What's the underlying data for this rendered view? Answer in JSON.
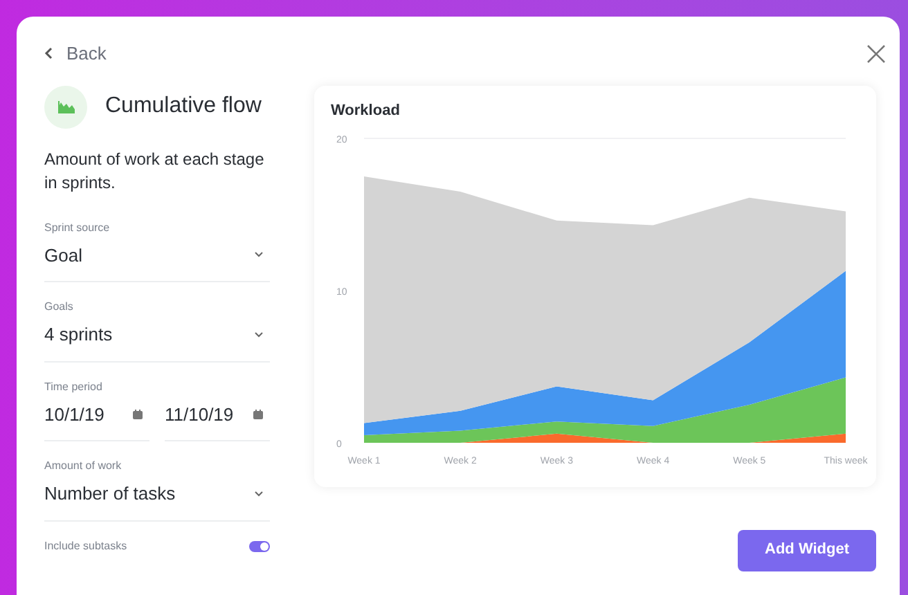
{
  "back": {
    "label": "Back"
  },
  "widget": {
    "title": "Cumulative flow",
    "description": "Amount of work at each stage in sprints."
  },
  "fields": [
    {
      "kind": "select",
      "label": "Sprint source",
      "value": "Goal"
    },
    {
      "kind": "select",
      "label": "Goals",
      "value": "4 sprints"
    },
    {
      "kind": "daterange",
      "label": "Time period",
      "start": "10/1/19",
      "end": "11/10/19"
    },
    {
      "kind": "select",
      "label": "Amount of work",
      "value": "Number of tasks"
    },
    {
      "kind": "toggle",
      "label": "Include subtasks",
      "on": true
    }
  ],
  "preview": {
    "title": "Workload",
    "chart_data": {
      "type": "area",
      "stacked": true,
      "categories": [
        "Week 1",
        "Week 2",
        "Week 3",
        "Week 4",
        "Week 5",
        "This week"
      ],
      "ylim": [
        0,
        20
      ],
      "yticks": [
        0,
        10,
        20
      ],
      "series": [
        {
          "color": "#fa6a2c",
          "values": [
            0,
            0,
            0.6,
            0,
            0,
            0.6
          ]
        },
        {
          "color": "#6cc559",
          "values": [
            0.5,
            0.8,
            0.8,
            1.1,
            2.5,
            3.7
          ]
        },
        {
          "color": "#4596f0",
          "values": [
            0.8,
            1.3,
            2.3,
            1.7,
            4.1,
            7.0
          ]
        },
        {
          "color": "#d4d4d4",
          "values": [
            16.2,
            14.4,
            10.9,
            11.5,
            9.5,
            3.9
          ]
        }
      ]
    }
  },
  "actions": {
    "add_widget": "Add Widget"
  }
}
